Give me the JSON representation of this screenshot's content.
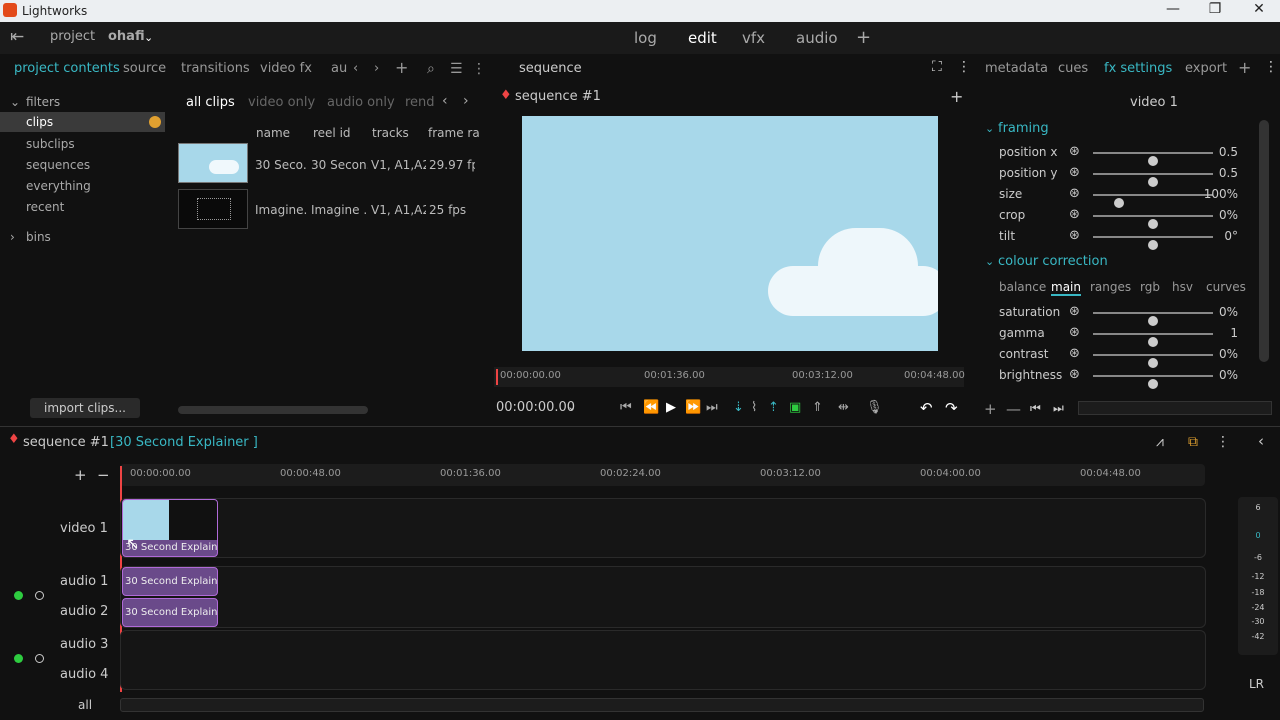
{
  "window": {
    "title": "Lightworks"
  },
  "menubar": {
    "project_label": "project",
    "project_name": "ohafi",
    "items": [
      "log",
      "edit",
      "vfx",
      "audio"
    ]
  },
  "left_tabs": [
    "project contents",
    "source",
    "transitions",
    "video fx",
    "au"
  ],
  "sidebar": {
    "filters": "filters",
    "clips": "clips",
    "items": [
      "subclips",
      "sequences",
      "everything",
      "recent"
    ],
    "bins": "bins",
    "import": "import clips..."
  },
  "clip_tabs": [
    "all clips",
    "video only",
    "audio only",
    "rend"
  ],
  "clip_table": {
    "headers": [
      "name",
      "reel id",
      "tracks",
      "frame ra"
    ],
    "rows": [
      [
        "30 Seco...",
        "30 Secon...",
        "V1, A1,A2",
        "29.97 fps"
      ],
      [
        "Imagine...",
        "Imagine ...",
        "V1, A1,A2",
        "25 fps"
      ]
    ]
  },
  "viewer": {
    "tab": "sequence",
    "title": "sequence #1",
    "timecodes": [
      "00:00:00.00",
      "00:01:36.00",
      "00:03:12.00",
      "00:04:48.00"
    ],
    "current_tc": "00:00:00.00"
  },
  "right_tabs": [
    "metadata",
    "cues",
    "fx settings",
    "export"
  ],
  "fx": {
    "track": "video 1",
    "framing_title": "framing",
    "framing": [
      {
        "label": "position x",
        "value": "0.5",
        "pos": 0.5
      },
      {
        "label": "position y",
        "value": "0.5",
        "pos": 0.5
      },
      {
        "label": "size",
        "value": "100%",
        "pos": 0.22
      },
      {
        "label": "crop",
        "value": "0%",
        "pos": 0.5
      },
      {
        "label": "tilt",
        "value": "0°",
        "pos": 0.5
      }
    ],
    "colour_title": "colour correction",
    "colour_tabs": [
      "balance",
      "main",
      "ranges",
      "rgb",
      "hsv",
      "curves"
    ],
    "colour": [
      {
        "label": "saturation",
        "value": "0%",
        "pos": 0.5
      },
      {
        "label": "gamma",
        "value": "1",
        "pos": 0.5
      },
      {
        "label": "contrast",
        "value": "0%",
        "pos": 0.5
      },
      {
        "label": "brightness",
        "value": "0%",
        "pos": 0.5
      }
    ]
  },
  "timeline": {
    "sequence": "sequence #1",
    "clip_name": "[30 Second Explainer ]",
    "ruler": [
      "00:00:00.00",
      "00:00:48.00",
      "00:01:36.00",
      "00:02:24.00",
      "00:03:12.00",
      "00:04:00.00",
      "00:04:48.00"
    ],
    "tracks": [
      "video 1",
      "audio 1",
      "audio 2",
      "audio 3",
      "audio 4"
    ],
    "all_label": "all",
    "clip_text": "30 Second Explaine",
    "meter": [
      "6",
      "0",
      "-6",
      "-12",
      "-18",
      "-24",
      "-30",
      "-42"
    ],
    "lr": "LR"
  },
  "colors": {
    "accent": "#39b8c4",
    "brand": "#e34a1a",
    "clip": "#6a4a8a",
    "playhead": "#e44"
  }
}
